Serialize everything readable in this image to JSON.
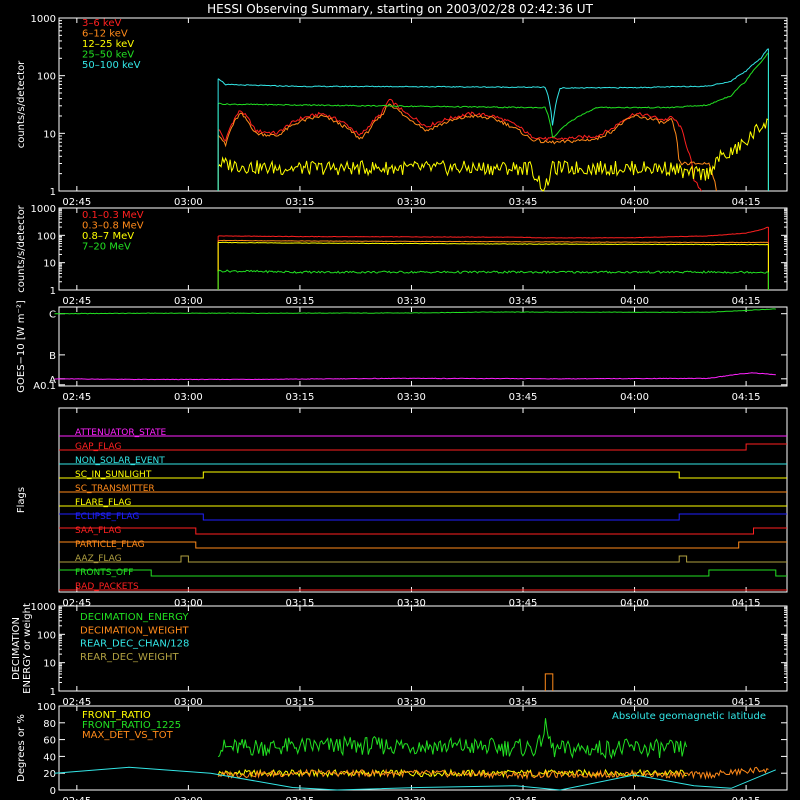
{
  "title": "HESSI Observing Summary, starting on 2003/02/28 02:42:36 UT",
  "time_ticks": [
    "02:45",
    "03:00",
    "03:15",
    "03:30",
    "03:45",
    "04:00",
    "04:15"
  ],
  "colors": {
    "background": "#000000",
    "axis": "#ffffff",
    "red": "#ff2020",
    "orange": "#ff8a1a",
    "yellow": "#ffff00",
    "green": "#22e022",
    "cyan": "#33e6e6",
    "magenta": "#ff22ff",
    "blue": "#2020ff",
    "olive": "#b0a040"
  },
  "chart_data": [
    {
      "type": "line",
      "panel": "count-rates",
      "ylabel": "counts/s/detector",
      "y_scale": "log",
      "ylim": [
        1,
        1000
      ],
      "y_ticks": [
        "1",
        "10",
        "100",
        "1000"
      ],
      "legend_placement": "top-left",
      "series": [
        {
          "name": "3–6 keV",
          "color": "#ff2020",
          "t": [
            "03:04",
            "03:05",
            "03:07",
            "03:09",
            "03:12",
            "03:15",
            "03:18",
            "03:21",
            "03:23",
            "03:24",
            "03:26",
            "03:27",
            "03:29",
            "03:32",
            "03:35",
            "03:38",
            "03:41",
            "03:44",
            "03:46",
            "03:48",
            "03:49",
            "03:50",
            "03:55",
            "03:57",
            "04:00",
            "04:02",
            "04:04",
            "04:05",
            "04:06",
            "04:07",
            "04:08",
            "04:09"
          ],
          "values": [
            12,
            7,
            25,
            11,
            10,
            18,
            22,
            15,
            9,
            12,
            22,
            38,
            23,
            13,
            18,
            22,
            20,
            14,
            9,
            8,
            8,
            8,
            9,
            12,
            22,
            20,
            17,
            19,
            14,
            6,
            1.5,
            1
          ]
        },
        {
          "name": "6–12 keV",
          "color": "#ff8a1a",
          "t": [
            "03:04",
            "03:05",
            "03:07",
            "03:09",
            "03:12",
            "03:15",
            "03:18",
            "03:21",
            "03:23",
            "03:24",
            "03:26",
            "03:27",
            "03:29",
            "03:32",
            "03:35",
            "03:38",
            "03:41",
            "03:44",
            "03:46",
            "03:48",
            "03:49",
            "03:50",
            "03:55",
            "03:57",
            "04:00",
            "04:02",
            "04:04",
            "04:05",
            "04:06",
            "04:07",
            "04:10",
            "04:11"
          ],
          "values": [
            10,
            6,
            22,
            10,
            9,
            16,
            20,
            13,
            8,
            10,
            20,
            33,
            20,
            11,
            16,
            20,
            18,
            12,
            8,
            7,
            7,
            7,
            8,
            11,
            20,
            18,
            15,
            17,
            3,
            3,
            3,
            1
          ]
        },
        {
          "name": "12–25 keV",
          "color": "#ffff00",
          "t": [
            "03:04",
            "03:10",
            "03:20",
            "03:30",
            "03:40",
            "03:46",
            "03:47",
            "03:48",
            "03:49",
            "03:55",
            "04:05",
            "04:07",
            "04:10",
            "04:11",
            "04:13",
            "04:15",
            "04:16",
            "04:17",
            "04:18"
          ],
          "values": [
            3,
            2.5,
            2.5,
            2.5,
            2.5,
            2.5,
            1.6,
            1,
            2.5,
            2.5,
            2.5,
            2,
            2,
            3.5,
            4.5,
            7,
            10,
            13,
            18
          ]
        },
        {
          "name": "25–50 keV",
          "color": "#22e022",
          "t": [
            "03:04",
            "03:05",
            "03:15",
            "03:25",
            "03:35",
            "03:45",
            "03:48",
            "03:49",
            "03:55",
            "04:05",
            "04:10",
            "04:13",
            "04:15",
            "04:17",
            "04:18"
          ],
          "values": [
            33,
            32,
            31,
            30,
            29,
            28,
            28,
            8,
            28,
            28,
            31,
            45,
            80,
            170,
            250
          ]
        },
        {
          "name": "50–100 keV",
          "color": "#33e6e6",
          "t": [
            "03:04",
            "03:05",
            "03:15",
            "03:25",
            "03:35",
            "03:45",
            "03:48",
            "03:49",
            "03:50",
            "04:00",
            "04:10",
            "04:13",
            "04:15",
            "04:17",
            "04:18"
          ],
          "values": [
            90,
            70,
            65,
            65,
            64,
            63,
            63,
            12,
            61,
            62,
            66,
            80,
            120,
            200,
            300
          ]
        }
      ]
    },
    {
      "type": "line",
      "panel": "high-energy-rates",
      "ylabel": "counts/s/detector",
      "y_scale": "log",
      "ylim": [
        1,
        1000
      ],
      "y_ticks": [
        "1",
        "10",
        "100",
        "1000"
      ],
      "legend_placement": "top-left",
      "series": [
        {
          "name": "0.1–0.3 MeV",
          "color": "#ff2020",
          "t": [
            "03:04",
            "03:15",
            "03:30",
            "03:45",
            "03:48",
            "04:00",
            "04:10",
            "04:15",
            "04:17",
            "04:18"
          ],
          "values": [
            95,
            90,
            88,
            85,
            80,
            82,
            95,
            120,
            160,
            200
          ]
        },
        {
          "name": "0.3–0.8 MeV",
          "color": "#ff8a1a",
          "t": [
            "03:04",
            "03:15",
            "03:30",
            "03:45",
            "04:00",
            "04:10",
            "04:18"
          ],
          "values": [
            65,
            62,
            60,
            58,
            56,
            55,
            55
          ]
        },
        {
          "name": "0.8–7 MeV",
          "color": "#ffff00",
          "t": [
            "03:04",
            "03:15",
            "03:30",
            "03:45",
            "04:00",
            "04:10",
            "04:18"
          ],
          "values": [
            55,
            52,
            50,
            48,
            47,
            46,
            46
          ]
        },
        {
          "name": "7–20 MeV",
          "color": "#22e022",
          "t": [
            "03:04",
            "03:15",
            "03:30",
            "03:45",
            "04:00",
            "04:10",
            "04:18"
          ],
          "values": [
            5,
            4.5,
            4.5,
            4.5,
            4.5,
            4.5,
            4.5
          ]
        }
      ]
    },
    {
      "type": "line",
      "panel": "goes",
      "ylabel": "GOES−10 [W m⁻²]",
      "y_ticks": [
        "A0.1",
        "A",
        "B",
        "C"
      ],
      "ylim": [
        -0.3,
        3
      ],
      "series": [
        {
          "color": "#22e022",
          "t": [
            "02:42",
            "02:55",
            "03:10",
            "03:30",
            "03:40",
            "04:00",
            "04:10",
            "04:15",
            "04:19"
          ],
          "values": [
            2.72,
            2.74,
            2.74,
            2.75,
            2.79,
            2.78,
            2.78,
            2.86,
            2.92
          ]
        },
        {
          "color": "#ff22ff",
          "t": [
            "02:42",
            "02:55",
            "03:10",
            "03:20",
            "03:30",
            "03:40",
            "03:50",
            "04:00",
            "04:10",
            "04:14",
            "04:16",
            "04:19"
          ],
          "values": [
            0.0,
            -0.03,
            -0.02,
            0.0,
            0.02,
            0.01,
            0.0,
            0.01,
            0.02,
            0.2,
            0.25,
            0.17
          ]
        }
      ]
    },
    {
      "type": "line",
      "panel": "flags",
      "ylabel": "Flags",
      "flags": [
        {
          "name": "ATTENUATOR_STATE",
          "color": "#ff22ff",
          "changes": [],
          "initial": 0
        },
        {
          "name": "GAP_FLAG",
          "color": "#ff2020",
          "changes": [
            "04:15"
          ],
          "initial": 0
        },
        {
          "name": "NON_SOLAR_EVENT",
          "color": "#33e6e6",
          "changes": [],
          "initial": 0
        },
        {
          "name": "SC_IN_SUNLIGHT",
          "color": "#ffff00",
          "changes": [
            "03:02",
            "04:06"
          ],
          "initial": 0
        },
        {
          "name": "SC_TRANSMITTER",
          "color": "#ff8a1a",
          "changes": [],
          "initial": 0
        },
        {
          "name": "FLARE_FLAG",
          "color": "#ffff00",
          "changes": [],
          "initial": 0
        },
        {
          "name": "ECLIPSE_FLAG",
          "color": "#2020ff",
          "changes": [
            "03:02",
            "04:06"
          ],
          "initial": 1
        },
        {
          "name": "SAA_FLAG",
          "color": "#ff2020",
          "changes": [
            "03:01",
            "04:16"
          ],
          "initial": 1
        },
        {
          "name": "PARTICLE_FLAG",
          "color": "#ff8a1a",
          "changes": [
            "03:01",
            "04:14"
          ],
          "initial": 1
        },
        {
          "name": "AAZ_FLAG",
          "color": "#b0a040",
          "changes": [
            "02:59",
            "03:00",
            "04:06",
            "04:07"
          ],
          "initial": 0
        },
        {
          "name": "FRONTS_OFF",
          "color": "#22e022",
          "changes": [
            "02:55",
            "04:10",
            "04:19"
          ],
          "initial": 1
        },
        {
          "name": "BAD_PACKETS",
          "color": "#ff2020",
          "changes": [],
          "initial": 0
        }
      ]
    },
    {
      "type": "line",
      "panel": "decimation",
      "ylabel": "DECIMATION ENERGY or weight",
      "y_scale": "log",
      "ylim": [
        1,
        1000
      ],
      "y_ticks": [
        "1",
        "10",
        "100",
        "1000"
      ],
      "legend_placement": "top-left",
      "series": [
        {
          "name": "DECIMATION_ENERGY",
          "color": "#22e022",
          "t": [],
          "values": []
        },
        {
          "name": "DECIMATION_WEIGHT",
          "color": "#ff8a1a",
          "t": [
            "03:48",
            "03:48",
            "03:49",
            "03:49"
          ],
          "values": [
            1,
            4,
            4,
            1
          ]
        },
        {
          "name": "REAR_DEC_CHAN/128",
          "color": "#33e6e6",
          "t": [],
          "values": []
        },
        {
          "name": "REAR_DEC_WEIGHT",
          "color": "#b0a040",
          "t": [],
          "values": []
        }
      ]
    },
    {
      "type": "line",
      "panel": "front-ratio",
      "ylabel": "Degrees or %",
      "ylim": [
        0,
        100
      ],
      "y_ticks": [
        "0",
        "20",
        "40",
        "60",
        "80",
        "100"
      ],
      "legend_placement": "top-left",
      "annotation": "Absolute geomagnetic latitude",
      "series": [
        {
          "name": "FRONT_RATIO",
          "color": "#ffff00",
          "t": [
            "03:04",
            "03:20",
            "03:40",
            "04:00",
            "04:07"
          ],
          "values": [
            20,
            20,
            20,
            20,
            20
          ]
        },
        {
          "name": "FRONT_RATIO_1225",
          "color": "#22e022",
          "t": [
            "03:04",
            "03:15",
            "03:30",
            "03:47",
            "03:48",
            "03:49",
            "04:00",
            "04:07"
          ],
          "values": [
            50,
            52,
            53,
            50,
            75,
            48,
            50,
            48
          ]
        },
        {
          "name": "MAX_DET_VS_TOT",
          "color": "#ff8a1a",
          "t": [
            "03:04",
            "03:15",
            "03:30",
            "03:45",
            "04:00",
            "04:07",
            "04:10",
            "04:18"
          ],
          "values": [
            18,
            20,
            20,
            18,
            19,
            18,
            18,
            25
          ]
        },
        {
          "name": "Absolute geomagnetic latitude",
          "color": "#33e6e6",
          "t": [
            "02:42",
            "02:52",
            "03:03",
            "03:14",
            "03:20",
            "03:31",
            "03:44",
            "03:50",
            "04:00",
            "04:08",
            "04:13",
            "04:19"
          ],
          "values": [
            20,
            27,
            20,
            3,
            0,
            3,
            5,
            0,
            18,
            5,
            2,
            24
          ]
        }
      ]
    }
  ]
}
